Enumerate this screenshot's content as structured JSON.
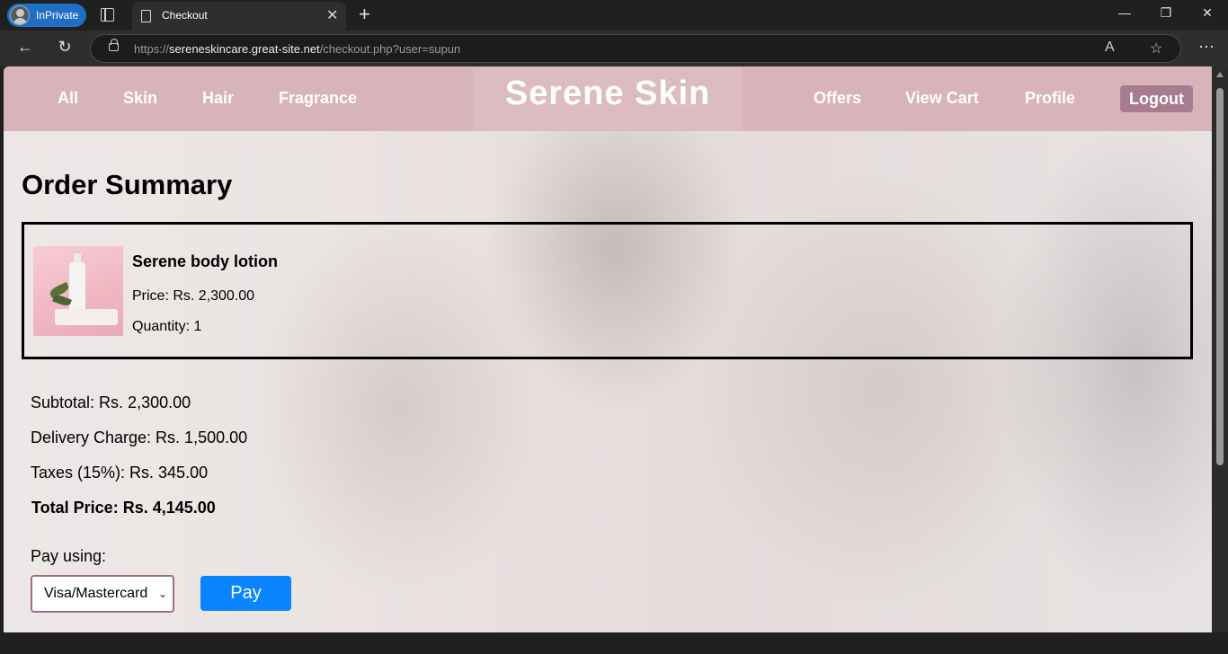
{
  "browser": {
    "inprivate_label": "InPrivate",
    "tab_title": "Checkout",
    "url_scheme": "https://",
    "url_host": "sereneskincare.great-site.net",
    "url_path": "/checkout.php?user=supun"
  },
  "nav": {
    "links_left": [
      "All",
      "Skin",
      "Hair",
      "Fragrance"
    ],
    "brand": "Serene Skin",
    "links_right": [
      "Offers",
      "View Cart",
      "Profile"
    ],
    "logout": "Logout",
    "colors": {
      "bar": "#d8b4ba",
      "logout_bg": "#a87c8e"
    }
  },
  "order": {
    "heading": "Order Summary",
    "items": [
      {
        "name": "Serene body lotion",
        "price": "Price: Rs. 2,300.00",
        "quantity": "Quantity: 1"
      }
    ],
    "subtotal": "Subtotal: Rs. 2,300.00",
    "delivery": "Delivery Charge: Rs. 1,500.00",
    "taxes": "Taxes (15%): Rs. 345.00",
    "total": "Total Price: Rs. 4,145.00"
  },
  "payment": {
    "label": "Pay using:",
    "method": "Visa/Mastercard",
    "button": "Pay",
    "button_color": "#0a84ff"
  }
}
